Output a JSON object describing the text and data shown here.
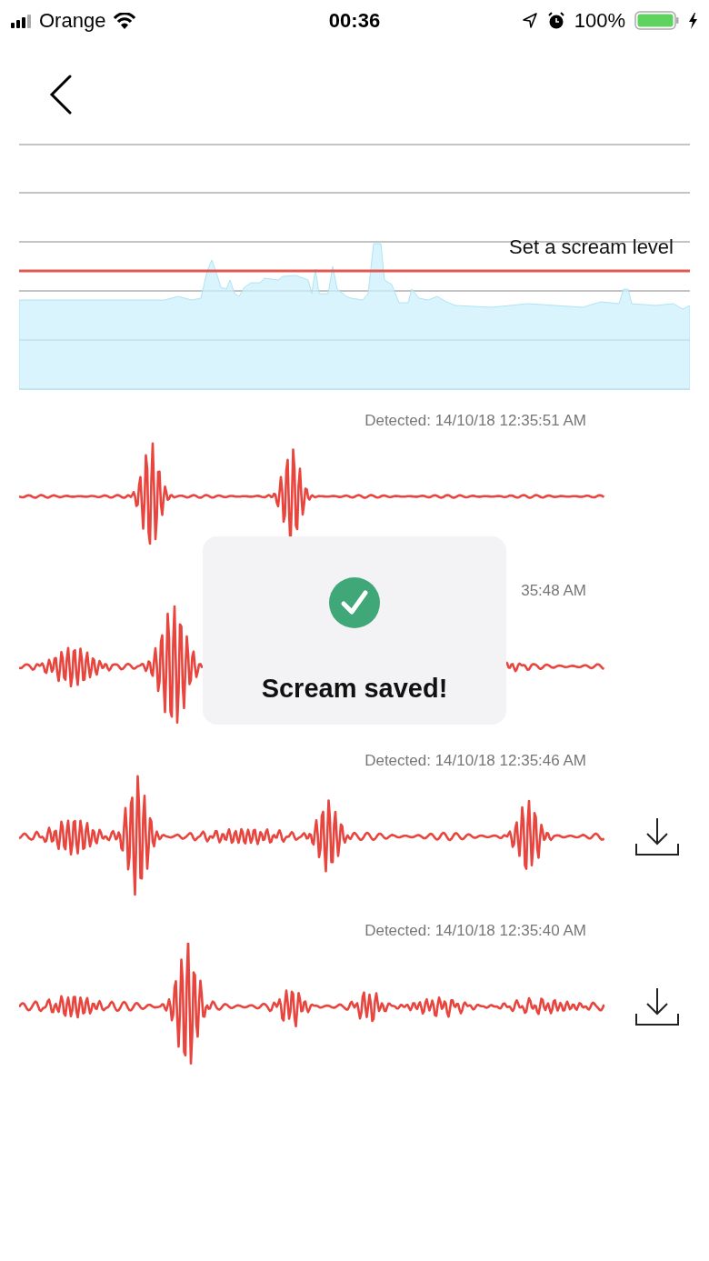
{
  "status_bar": {
    "carrier": "Orange",
    "time": "00:36",
    "battery": "100%"
  },
  "scream_level": {
    "label": "Set a scream level"
  },
  "detections": [
    {
      "timestamp": "Detected: 14/10/18 12:35:51 AM",
      "download": false
    },
    {
      "timestamp": "35:48 AM",
      "download": false
    },
    {
      "timestamp": "Detected: 14/10/18 12:35:46 AM",
      "download": true
    },
    {
      "timestamp": "Detected: 14/10/18 12:35:40 AM",
      "download": true
    }
  ],
  "toast": {
    "message": "Scream saved!"
  }
}
